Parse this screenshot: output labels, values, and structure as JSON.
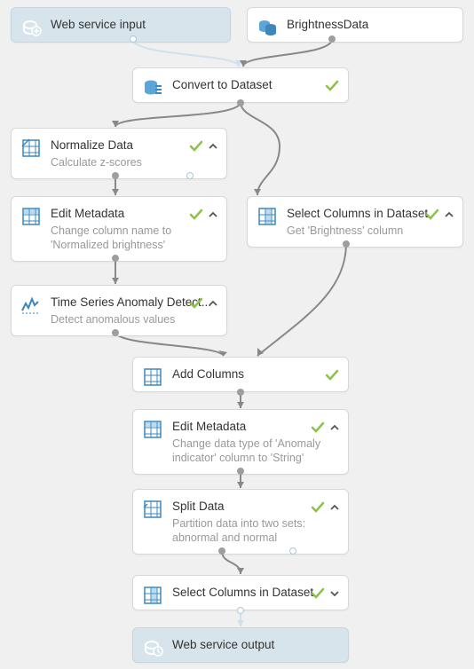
{
  "nodes": {
    "web_input": {
      "title": "Web service input"
    },
    "brightness_data": {
      "title": "BrightnessData"
    },
    "convert_dataset": {
      "title": "Convert to Dataset"
    },
    "normalize": {
      "title": "Normalize Data",
      "subtitle": "Calculate z-scores"
    },
    "edit_meta1": {
      "title": "Edit Metadata",
      "subtitle": "Change column name to 'Normalized brightness'"
    },
    "anomaly": {
      "title": "Time Series Anomaly Detect...",
      "subtitle": "Detect anomalous values"
    },
    "select_cols1": {
      "title": "Select Columns in Dataset",
      "subtitle": "Get 'Brightness' column"
    },
    "add_cols": {
      "title": "Add Columns"
    },
    "edit_meta2": {
      "title": "Edit Metadata",
      "subtitle": "Change data type of 'Anomaly indicator' column to 'String'"
    },
    "split": {
      "title": "Split Data",
      "subtitle": "Partition data into two sets: abnormal and normal"
    },
    "select_cols2": {
      "title": "Select Columns in Dataset"
    },
    "web_output": {
      "title": "Web service output"
    }
  }
}
